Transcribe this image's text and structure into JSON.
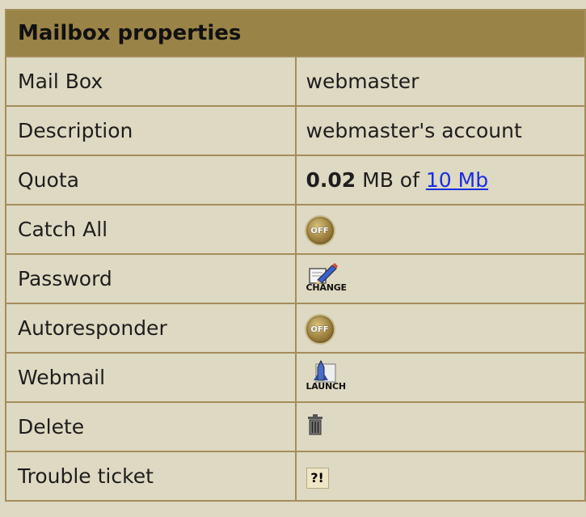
{
  "panel": {
    "title": "Mailbox properties"
  },
  "rows": {
    "mailbox": {
      "label": "Mail Box",
      "value": "webmaster"
    },
    "description": {
      "label": "Description",
      "value": "webmaster's account"
    },
    "quota": {
      "label": "Quota",
      "used": "0.02",
      "unit_text": " MB of ",
      "limit_link": "10 Mb"
    },
    "catch_all": {
      "label": "Catch All",
      "button": "OFF"
    },
    "password": {
      "label": "Password",
      "button": "CHANGE"
    },
    "autoresponder": {
      "label": "Autoresponder",
      "button": "OFF"
    },
    "webmail": {
      "label": "Webmail",
      "button": "LAUNCH"
    },
    "delete": {
      "label": "Delete",
      "icon": "trash-icon"
    },
    "trouble_ticket": {
      "label": "Trouble ticket",
      "button": "?!"
    }
  },
  "colors": {
    "background": "#ded9c2",
    "header": "#9a8347",
    "border": "#a58d5b",
    "link": "#1a2ee0"
  }
}
